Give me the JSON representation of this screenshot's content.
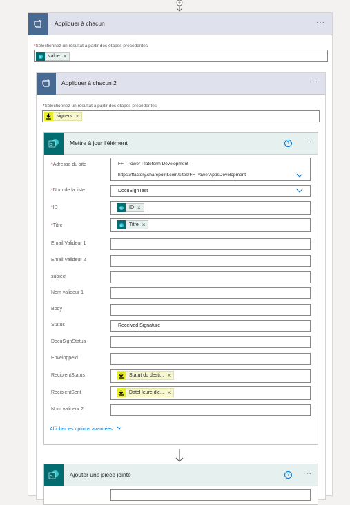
{
  "outer_loop": {
    "title": "Appliquer à chacun",
    "more": "···",
    "select_label": "Sélectionnez un résultat à partir des étapes précédentes",
    "required_star": "*",
    "token": {
      "label": "value",
      "remove": "×",
      "icon": "sharepoint-icon"
    }
  },
  "inner_loop": {
    "title": "Appliquer à chacun 2",
    "more": "···",
    "select_label": "Sélectionnez un résultat à partir des étapes précédentes",
    "required_star": "*",
    "token": {
      "label": "signers",
      "remove": "×",
      "icon": "docusign-icon"
    }
  },
  "update_item": {
    "title": "Mettre à jour l'élément",
    "help": "?",
    "more": "···",
    "fields": {
      "site_address": {
        "label": "Adresse du site",
        "line1": "FF - Power Plateform Development -",
        "line2": "https://ffactory.sharepoint.com/sites/FF-PowerAppsDevelopment"
      },
      "list_name": {
        "label": "Nom de la liste",
        "value": "DocuSignTest"
      },
      "id": {
        "label": "ID",
        "token": "ID",
        "remove": "×"
      },
      "titre": {
        "label": "Titre",
        "token": "Titre",
        "remove": "×"
      },
      "email_validator_1": {
        "label": "Email Valideur 1",
        "value": ""
      },
      "email_validator_2": {
        "label": "Email Valideur 2",
        "value": ""
      },
      "subject": {
        "label": "subject",
        "value": ""
      },
      "nom_valideur_1": {
        "label": "Nom valideur 1",
        "value": ""
      },
      "body": {
        "label": "Body",
        "value": ""
      },
      "status": {
        "label": "Status",
        "value": "Received Signature"
      },
      "docusign_status": {
        "label": "DocuSignStatus",
        "value": ""
      },
      "envelope_id": {
        "label": "EnveloppeId",
        "value": ""
      },
      "recipient_status": {
        "label": "RecipientStatus",
        "token": "Statut du desti...",
        "remove": "×"
      },
      "recipient_sent": {
        "label": "RecipientSent",
        "token": "DateHeure d'e...",
        "remove": "×"
      },
      "nom_valideur_2": {
        "label": "Nom valideur 2",
        "value": ""
      }
    },
    "advanced_link": "Afficher les options avancées"
  },
  "attach": {
    "title": "Ajouter une pièce jointe",
    "help": "?",
    "more": "···"
  },
  "colors": {
    "sharepoint": "#036c70",
    "docusign": "#e9ee2b",
    "loop": "#486991",
    "link": "#0078d4",
    "required": "#a4262c"
  }
}
